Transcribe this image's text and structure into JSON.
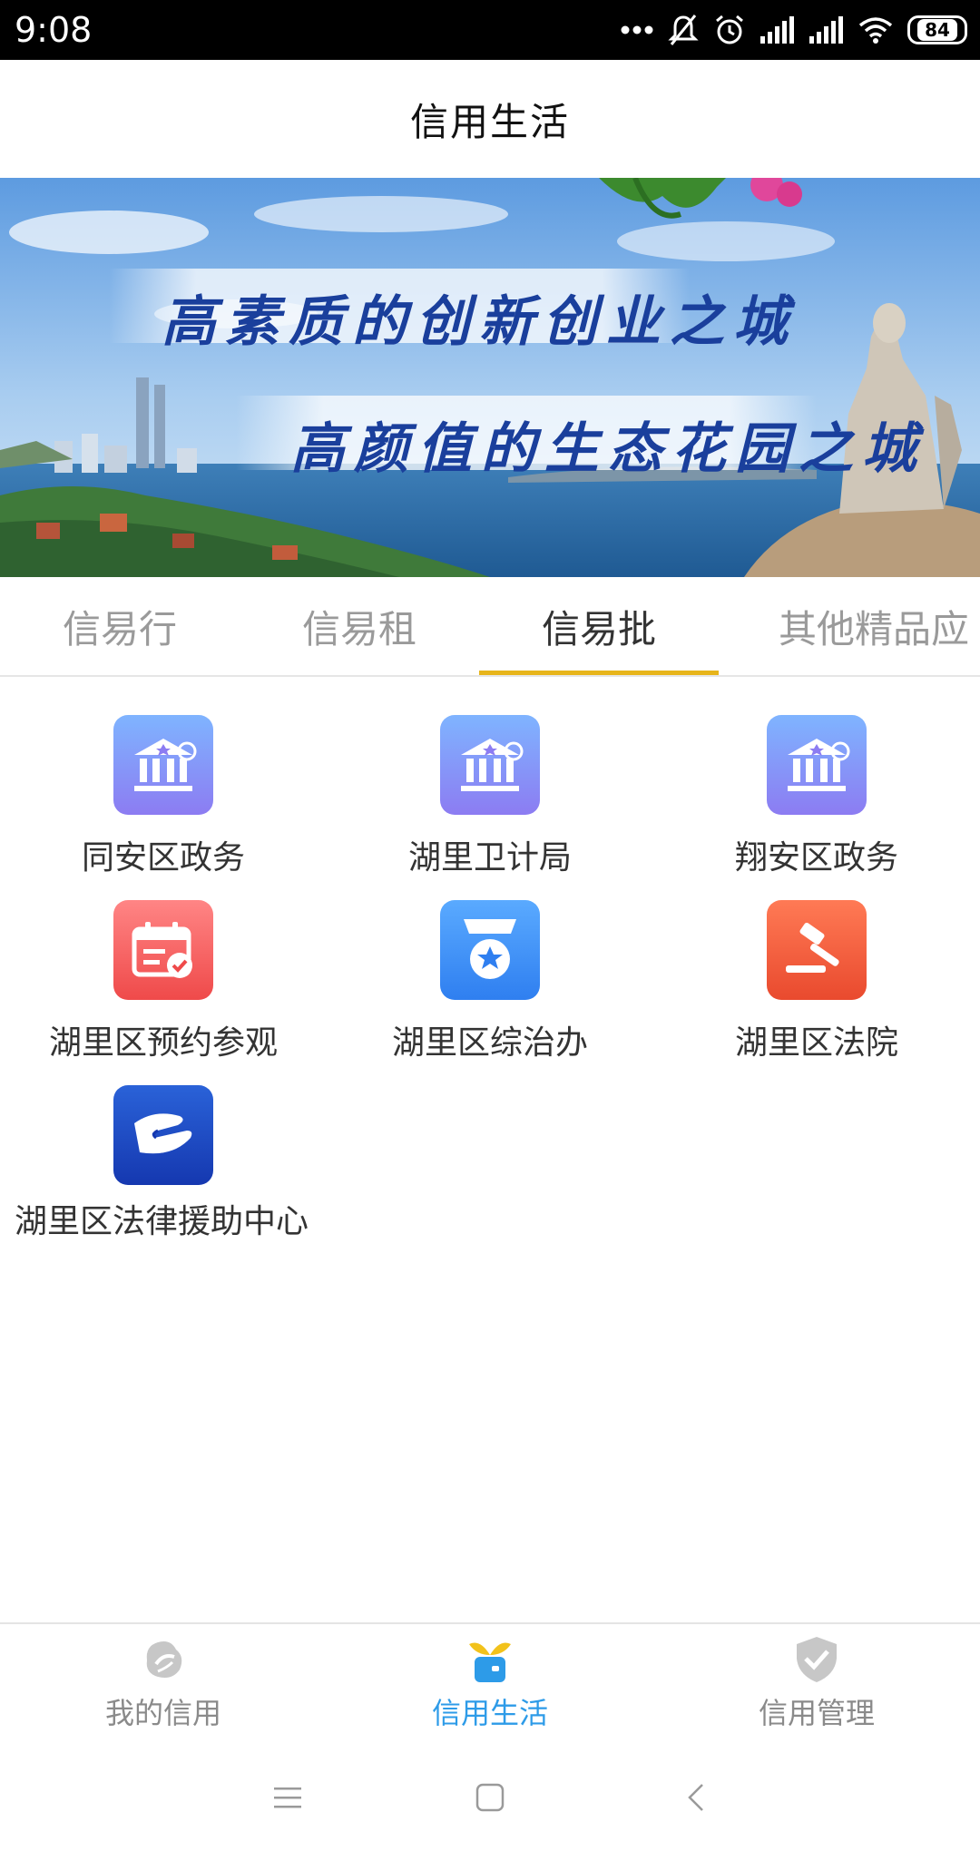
{
  "status_bar": {
    "time": "9:08",
    "battery": "84",
    "icons": [
      "more-dots-icon",
      "silent-bell-icon",
      "alarm-icon",
      "signal-icon",
      "signal-icon",
      "wifi-icon",
      "battery-icon"
    ]
  },
  "header": {
    "title": "信用生活"
  },
  "banner": {
    "slogan_1": "高素质的创新创业之城",
    "slogan_2": "高颜值的生态花园之城"
  },
  "tabs": [
    {
      "label": "信易行",
      "active": false
    },
    {
      "label": "信易租",
      "active": false
    },
    {
      "label": "信易批",
      "active": true
    },
    {
      "label": "其他精品应",
      "active": false
    }
  ],
  "apps": [
    {
      "label": "同安区政务",
      "icon": "government-building-icon"
    },
    {
      "label": "湖里卫计局",
      "icon": "government-building-icon"
    },
    {
      "label": "翔安区政务",
      "icon": "government-building-icon"
    },
    {
      "label": "湖里区预约参观",
      "icon": "calendar-check-icon"
    },
    {
      "label": "湖里区综治办",
      "icon": "police-badge-icon"
    },
    {
      "label": "湖里区法院",
      "icon": "gavel-icon"
    },
    {
      "label": "湖里区法律援助中心",
      "icon": "helping-hands-icon"
    }
  ],
  "bottom_nav": [
    {
      "label": "我的信用",
      "icon": "credit-leaf-icon",
      "active": false
    },
    {
      "label": "信用生活",
      "icon": "sprout-bag-icon",
      "active": true
    },
    {
      "label": "信用管理",
      "icon": "shield-check-icon",
      "active": false
    }
  ],
  "colors": {
    "accent": "#2d9be8",
    "tab_indicator": "#e7b51b",
    "inactive_text": "#9a9a9a"
  }
}
